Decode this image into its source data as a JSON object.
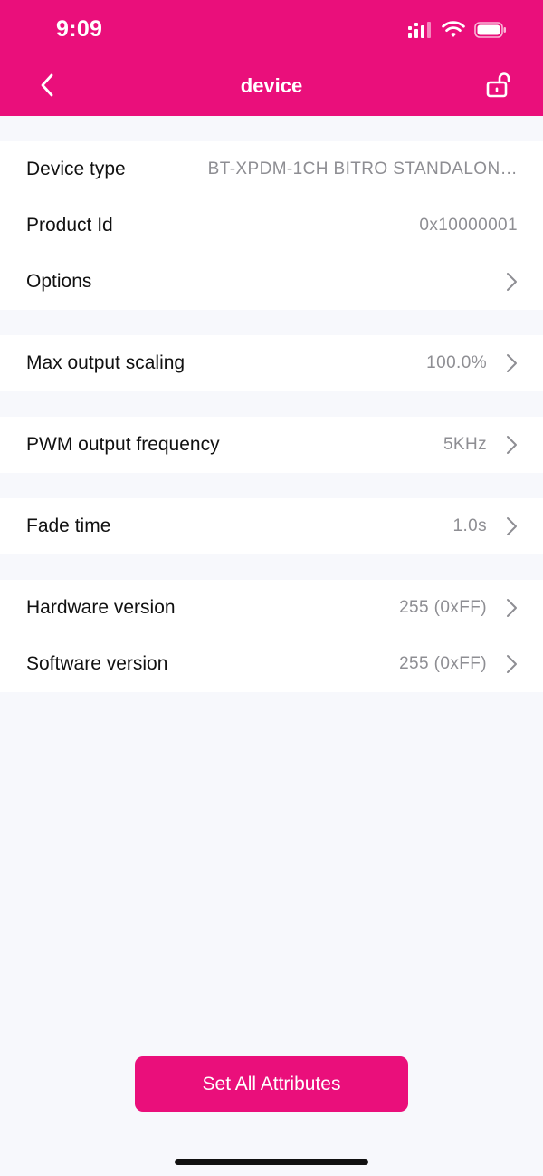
{
  "status_bar": {
    "time": "9:09"
  },
  "nav": {
    "title": "device"
  },
  "groups": [
    {
      "rows": [
        {
          "label": "Device type",
          "value": "BT-XPDM-1CH BITRO STANDALON…"
        },
        {
          "label": "Product Id",
          "value": "0x10000001"
        },
        {
          "label": "Options",
          "value": ""
        }
      ]
    },
    {
      "rows": [
        {
          "label": "Max output scaling",
          "value": "100.0%"
        }
      ]
    },
    {
      "rows": [
        {
          "label": "PWM output frequency",
          "value": "5KHz"
        }
      ]
    },
    {
      "rows": [
        {
          "label": "Fade time",
          "value": "1.0s"
        }
      ]
    },
    {
      "rows": [
        {
          "label": "Hardware version",
          "value": "255 (0xFF)"
        },
        {
          "label": "Software version",
          "value": "255 (0xFF)"
        }
      ]
    }
  ],
  "actions": {
    "set_all_label": "Set All Attributes"
  },
  "colors": {
    "accent": "#ea0f7b",
    "background": "#f7f8fc",
    "label": "#111111",
    "secondary": "#8e8e93"
  },
  "icons": {
    "back": "chevron-left-icon",
    "lock": "unlocked-lock-icon",
    "row": "chevron-right-icon"
  }
}
